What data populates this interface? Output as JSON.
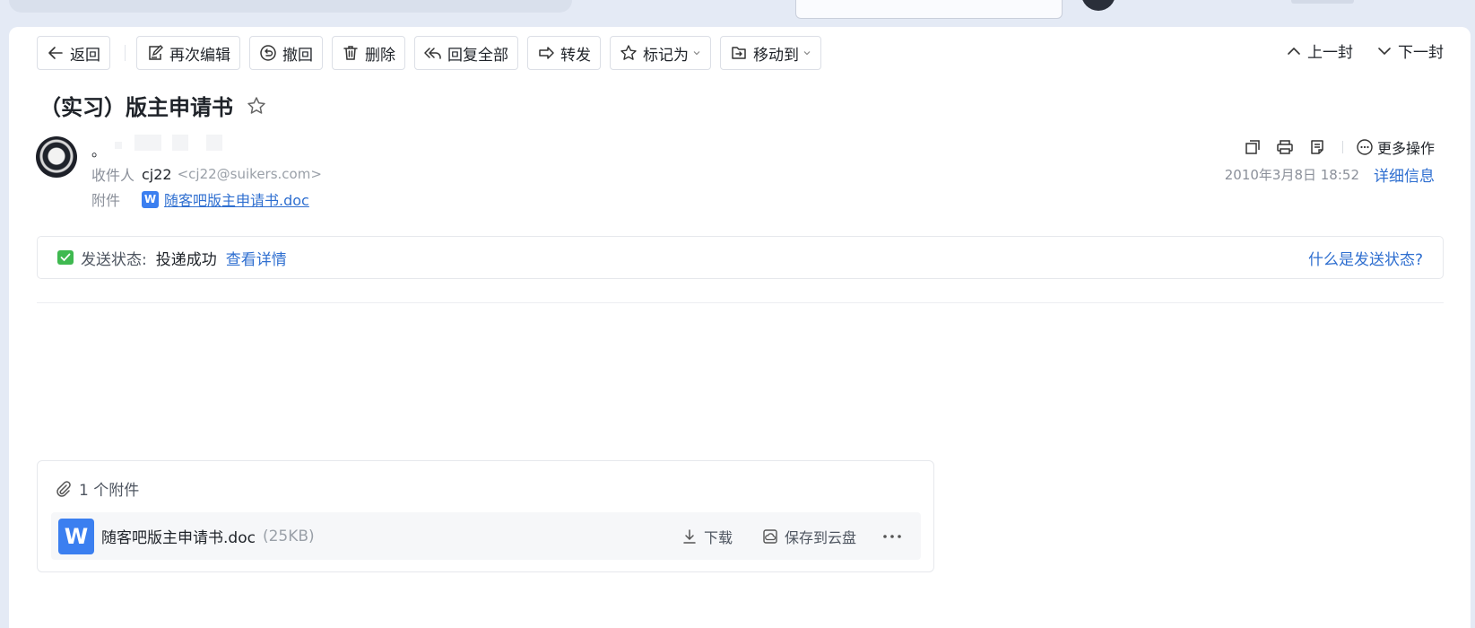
{
  "toolbar": {
    "back": "返回",
    "re_edit": "再次编辑",
    "recall": "撤回",
    "delete": "删除",
    "reply_all": "回复全部",
    "forward": "转发",
    "mark_as": "标记为",
    "move_to": "移动到"
  },
  "nav": {
    "prev": "上一封",
    "next": "下一封"
  },
  "email": {
    "subject": "（实习）版主申请书",
    "sender_name": "。",
    "recipient_label": "收件人",
    "recipient_name": "cj22",
    "recipient_addr": "<cj22@suikers.com>",
    "attachment_label": "附件",
    "attachment_name": "随客吧版主申请书.doc",
    "date": "2010年3月8日 18:52",
    "detail_link": "详细信息",
    "more_ops": "更多操作"
  },
  "status": {
    "label": "发送状态:",
    "value": "投递成功",
    "view_details": "查看详情",
    "help": "什么是发送状态?"
  },
  "attachments": {
    "count_label": "1 个附件",
    "word_letter": "W",
    "file_name": "随客吧版主申请书.doc",
    "file_size": "(25KB)",
    "download": "下载",
    "save_cloud": "保存到云盘"
  },
  "colors": {
    "accent": "#2f6fd0",
    "word_blue": "#3b7ff0",
    "success_green": "#3fb950"
  }
}
